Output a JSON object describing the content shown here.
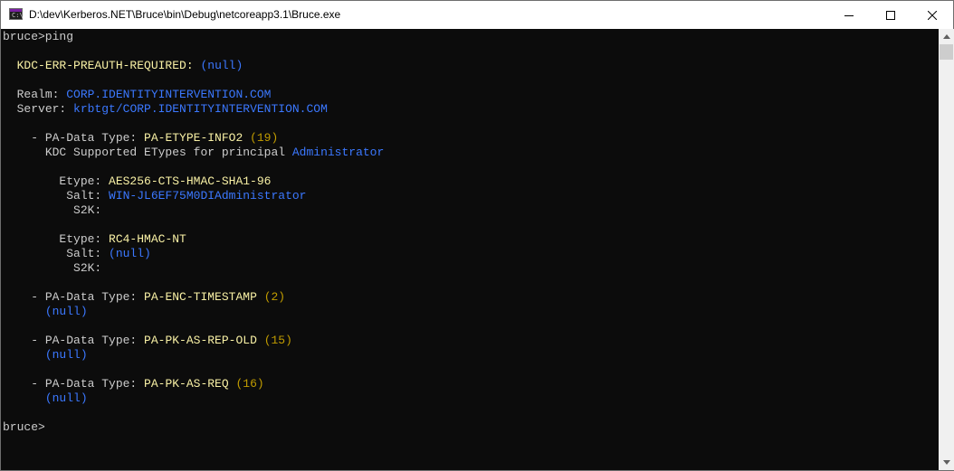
{
  "window": {
    "title": "D:\\dev\\Kerberos.NET\\Bruce\\bin\\Debug\\netcoreapp3.1\\Bruce.exe",
    "app_icon_glyph": "C:\\",
    "icons": [
      "console-app-icon",
      "minimize-icon",
      "maximize-icon",
      "close-icon",
      "scroll-up-arrow-icon",
      "scroll-down-arrow-icon"
    ]
  },
  "colors": {
    "console_bg": "#0c0c0c",
    "default_text": "#cccccc",
    "label_yellow": "#f9f1a5",
    "value_blue": "#3b78ff",
    "number_gold": "#c19c00"
  },
  "console": {
    "prompt_command": "bruce>ping",
    "error": {
      "code": "KDC-ERR-PREAUTH-REQUIRED:",
      "value": "(null)"
    },
    "realm": {
      "label": "Realm: ",
      "value": "CORP.IDENTITYINTERVENTION.COM"
    },
    "server": {
      "label": "Server: ",
      "value": "krbtgt/CORP.IDENTITYINTERVENTION.COM"
    },
    "pa_label": "- PA-Data Type: ",
    "pa1": {
      "type": "PA-ETYPE-INFO2",
      "num": "(19)",
      "supported_text": "KDC Supported ETypes for principal ",
      "principal": "Administrator",
      "etype1": {
        "etype_label": "Etype: ",
        "etype": "AES256-CTS-HMAC-SHA1-96",
        "salt_label": "Salt: ",
        "salt": "WIN-JL6EF75M0DIAdministrator",
        "s2k_label": "S2K:"
      },
      "etype2": {
        "etype_label": "Etype: ",
        "etype": "RC4-HMAC-NT",
        "salt_label": "Salt: ",
        "salt": "(null)",
        "s2k_label": "S2K:"
      }
    },
    "pa2": {
      "type": "PA-ENC-TIMESTAMP",
      "num": "(2)",
      "value": "(null)"
    },
    "pa3": {
      "type": "PA-PK-AS-REP-OLD",
      "num": "(15)",
      "value": "(null)"
    },
    "pa4": {
      "type": "PA-PK-AS-REQ",
      "num": "(16)",
      "value": "(null)"
    },
    "final_prompt": "bruce>"
  }
}
